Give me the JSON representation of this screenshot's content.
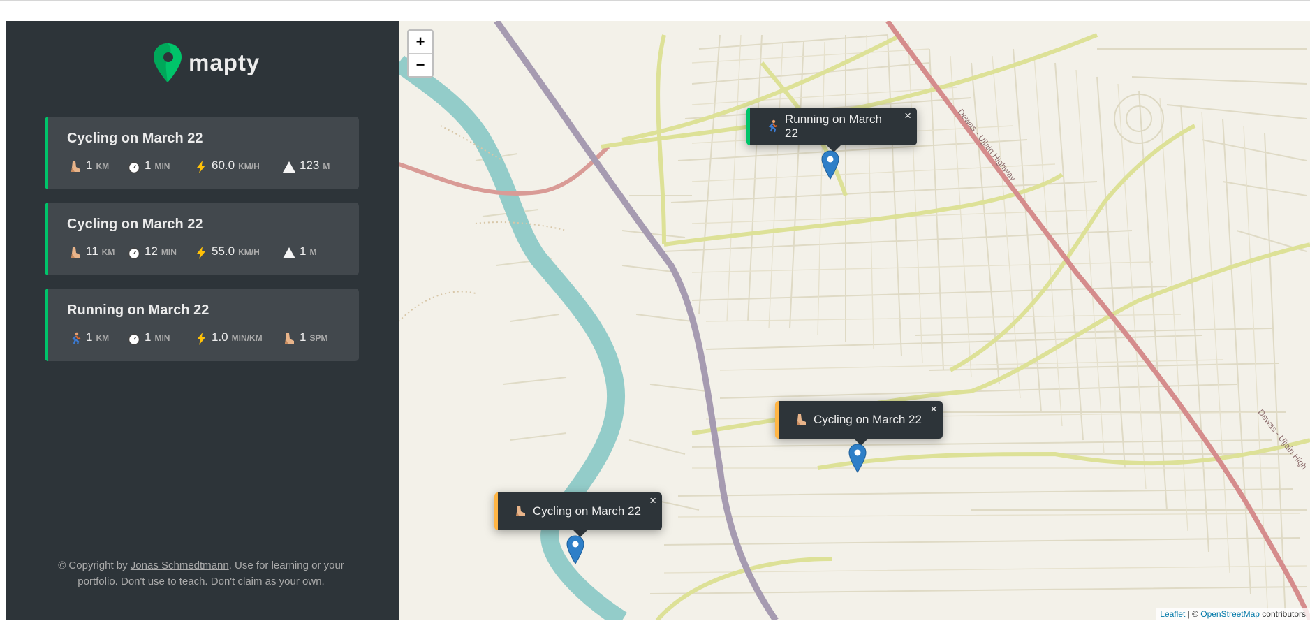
{
  "brand": {
    "name": "mapty",
    "accent": "#00c46a",
    "cycling_color": "#ffb545"
  },
  "workouts": [
    {
      "type": "cycling",
      "title": "Cycling on March 22",
      "details": [
        {
          "icon": "cycling-icon",
          "value": "1",
          "unit": "km"
        },
        {
          "icon": "stopwatch-icon",
          "value": "1",
          "unit": "min"
        },
        {
          "icon": "lightning-icon",
          "value": "60.0",
          "unit": "km/h"
        },
        {
          "icon": "mountain-icon",
          "value": "123",
          "unit": "m"
        }
      ]
    },
    {
      "type": "cycling",
      "title": "Cycling on March 22",
      "details": [
        {
          "icon": "cycling-icon",
          "value": "11",
          "unit": "km"
        },
        {
          "icon": "stopwatch-icon",
          "value": "12",
          "unit": "min"
        },
        {
          "icon": "lightning-icon",
          "value": "55.0",
          "unit": "km/h"
        },
        {
          "icon": "mountain-icon",
          "value": "1",
          "unit": "m"
        }
      ]
    },
    {
      "type": "running",
      "title": "Running on March 22",
      "details": [
        {
          "icon": "running-icon",
          "value": "1",
          "unit": "km"
        },
        {
          "icon": "stopwatch-icon",
          "value": "1",
          "unit": "min"
        },
        {
          "icon": "lightning-icon",
          "value": "1.0",
          "unit": "min/km"
        },
        {
          "icon": "footprint-icon",
          "value": "1",
          "unit": "spm"
        }
      ]
    }
  ],
  "copyright": {
    "prefix": "© Copyright by ",
    "author": "Jonas Schmedtmann",
    "suffix": ". Use for learning or your portfolio. Don't use to teach. Don't claim as your own."
  },
  "map": {
    "zoom_in": "+",
    "zoom_out": "−",
    "popups": [
      {
        "type": "running",
        "label": "Running on March 22",
        "close": "×"
      },
      {
        "type": "cycling",
        "label": "Cycling on March 22",
        "close": "×"
      },
      {
        "type": "cycling",
        "label": "Cycling on March 22",
        "close": "×"
      }
    ],
    "road_labels": [
      "Dewas - Ujjain Highway",
      "Dewas - Ujjain High"
    ],
    "attribution": {
      "leaflet": "Leaflet",
      "separator": " | © ",
      "osm": "OpenStreetMap",
      "suffix": " contributors"
    }
  }
}
